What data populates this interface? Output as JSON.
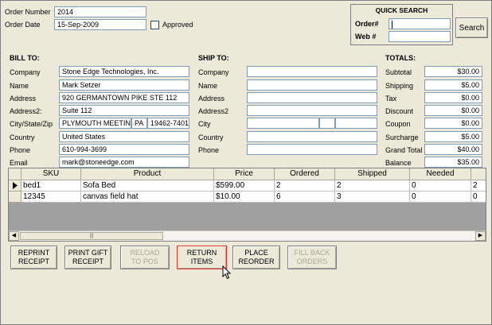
{
  "header": {
    "order_number_label": "Order Number",
    "order_number": "2014",
    "order_date_label": "Order Date",
    "order_date": "15-Sep-2009",
    "approved_label": "Approved"
  },
  "quick_search": {
    "title": "QUICK SEARCH",
    "order_label": "Order#",
    "web_label": "Web #",
    "search_button": "Search"
  },
  "bill_to": {
    "title": "BILL TO:",
    "labels": {
      "company": "Company",
      "name": "Name",
      "address": "Address",
      "address2": "Address2:",
      "city_state_zip": "City/State/Zip",
      "country": "Country",
      "phone": "Phone",
      "email": "Email"
    },
    "company": "Stone Edge Technologies, Inc.",
    "name": "Mark Setzer",
    "address": "920 GERMANTOWN PIKE STE 112",
    "address2": "Suite 112",
    "city": "PLYMOUTH MEETING",
    "state": "PA",
    "zip": "19462-7401",
    "country": "United States",
    "phone": "610-994-3699",
    "email": "mark@stoneedge.com"
  },
  "ship_to": {
    "title": "SHIP TO:",
    "labels": {
      "company": "Company",
      "name": "Name",
      "address": "Address",
      "address2": "Address2",
      "city": "City",
      "country": "Country",
      "phone": "Phone"
    }
  },
  "totals": {
    "title": "TOTALS:",
    "rows": [
      {
        "label": "Subtotal",
        "value": "$30.00"
      },
      {
        "label": "Shipping",
        "value": "$5.00"
      },
      {
        "label": "Tax",
        "value": "$0.00"
      },
      {
        "label": "Discount",
        "value": "$0.00"
      },
      {
        "label": "Coupon",
        "value": "$0.00"
      },
      {
        "label": "Surcharge",
        "value": "$5.00"
      },
      {
        "label": "Grand Total",
        "value": "$40.00"
      },
      {
        "label": "Balance",
        "value": "$35.00"
      }
    ]
  },
  "items_grid": {
    "columns": [
      "SKU",
      "Product",
      "Price",
      "Ordered",
      "Shipped",
      "Needed",
      ""
    ],
    "rows": [
      {
        "sku": "bed1",
        "product": "Sofa Bed",
        "price": "$599.00",
        "ordered": "2",
        "shipped": "2",
        "needed": "0",
        "extra": "2"
      },
      {
        "sku": "12345",
        "product": "canvas field hat",
        "price": "$10.00",
        "ordered": "6",
        "shipped": "3",
        "needed": "0",
        "extra": "0"
      }
    ]
  },
  "actions": {
    "reprint_receipt": [
      "REPRINT",
      "RECEIPT"
    ],
    "print_gift_receipt": [
      "PRINT GIFT",
      "RECEIPT"
    ],
    "reload_to_pos": [
      "RELOAD",
      "TO POS"
    ],
    "return_items": [
      "RETURN",
      "ITEMS"
    ],
    "place_reorder": [
      "PLACE",
      "REORDER"
    ],
    "fill_back_orders": [
      "FILL BACK",
      "ORDERS"
    ]
  }
}
